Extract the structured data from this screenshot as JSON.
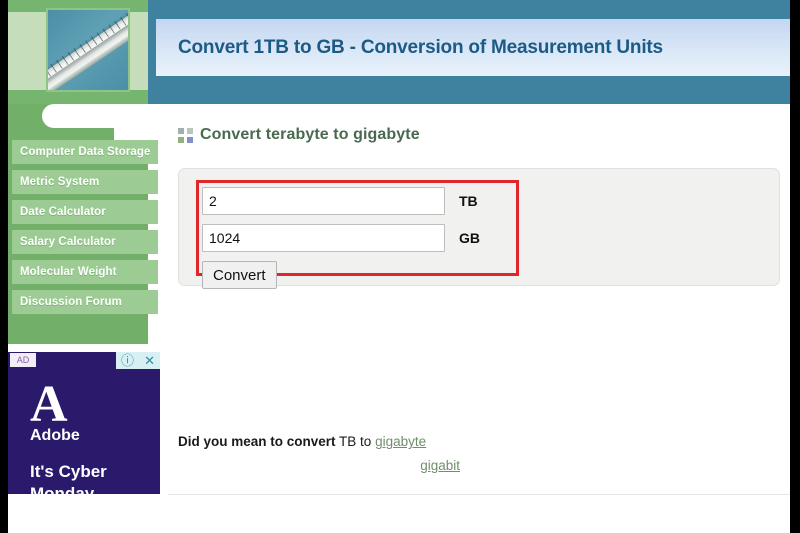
{
  "header": {
    "title": "Convert 1TB to GB - Conversion of Measurement Units",
    "logo_alt": "ruler-photo"
  },
  "sidebar": {
    "items": [
      {
        "label": "Computer Data Storage"
      },
      {
        "label": "Metric System"
      },
      {
        "label": "Date Calculator"
      },
      {
        "label": "Salary Calculator"
      },
      {
        "label": "Molecular Weight"
      },
      {
        "label": "Discussion Forum"
      }
    ]
  },
  "ad": {
    "badge": "AD",
    "info_icon": "ⓘ",
    "close_icon": "✕",
    "brand_mark": "A",
    "brand_name": "Adobe",
    "headline": "It's Cyber Monday"
  },
  "main": {
    "heading": "Convert terabyte to gigabyte",
    "form": {
      "from_value": "2",
      "from_unit": "TB",
      "to_value": "1024",
      "to_unit": "GB",
      "submit_label": "Convert",
      "from_placeholder": "",
      "to_placeholder": ""
    },
    "did_you_mean": {
      "lead": "Did you mean to convert",
      "middle": "TB to",
      "links": [
        "gigabyte",
        "gigabit"
      ]
    }
  },
  "colors": {
    "header_teal": "#3e82a0",
    "header_green": "#72b06a",
    "title_blue": "#1d5a86",
    "nav_green": "#9ccb93",
    "highlight_red": "#e0262a",
    "link_green": "#6f8f6a",
    "ad_purple": "#2b1a6b"
  }
}
